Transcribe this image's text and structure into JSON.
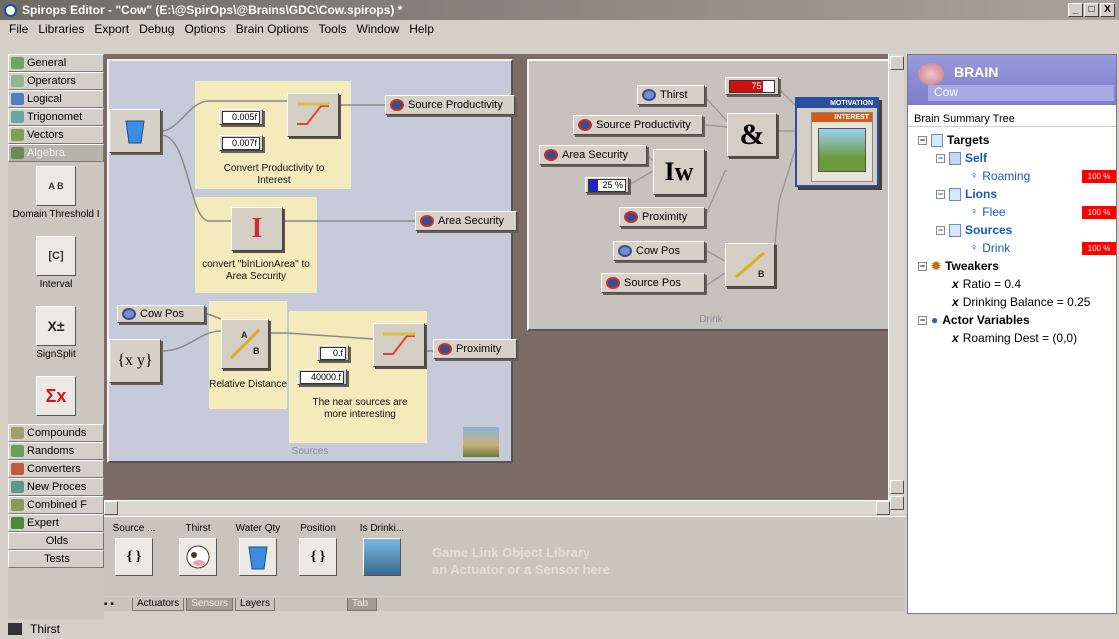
{
  "window": {
    "title": "Spirops Editor - \"Cow\" (E:\\@SpirOps\\@Brains\\GDC\\Cow.spirops) *",
    "min": "_",
    "max": "□",
    "close": "X"
  },
  "menu": [
    "File",
    "Libraries",
    "Export",
    "Debug",
    "Options",
    "Brain Options",
    "Tools",
    "Window",
    "Help"
  ],
  "palette": {
    "categories_top": [
      "General",
      "Operators",
      "Logical",
      "Trigonomet",
      "Vectors",
      "Algebra"
    ],
    "tools": [
      {
        "label": "Domain Threshold I",
        "glyph": "A B"
      },
      {
        "label": "Interval",
        "glyph": "[C]"
      },
      {
        "label": "SignSplit",
        "glyph": "X±"
      },
      {
        "label": "",
        "glyph": "Σx"
      }
    ],
    "categories_bottom": [
      "Compounds",
      "Randoms",
      "Converters",
      "New Proces",
      "Combined F",
      "Expert",
      "Olds",
      "Tests"
    ]
  },
  "sources_sheet": {
    "caption": "Sources",
    "values": {
      "v1": "0.005f",
      "v2": "0.007f",
      "v3": "0.f",
      "v4": "40000.f"
    },
    "outputs": [
      "Source Productivity",
      "Area Security",
      "Proximity"
    ],
    "input_cowpos": "Cow Pos",
    "captions": {
      "c1": "Convert Productivity to Interest",
      "c2": "convert \"bInLionArea\" to Area Security",
      "c3": "Relative Distance",
      "c4": "The near sources are more interesting"
    },
    "vec_glyph": "{x y}"
  },
  "drink_sheet": {
    "caption": "Drink",
    "inputs": [
      "Thirst",
      "Source Productivity",
      "Area Security",
      "Proximity",
      "Cow Pos",
      "Source Pos"
    ],
    "pct_75": "75 %",
    "pct_25": "25 %",
    "motivation": "MOTIVATION",
    "interest": "INTEREST",
    "and_glyph": "&",
    "iw_glyph": "Iw"
  },
  "library": {
    "items": [
      "Source ...",
      "Thirst",
      "Water Qty",
      "Position",
      "Is Drinki..."
    ],
    "ghost": [
      "Game Link Object Library",
      "an Actuator or a Sensor here"
    ],
    "tabs": [
      "Actuators",
      "Sensors",
      "Layers"
    ],
    "tab2": "Tab"
  },
  "brain": {
    "title": "BRAIN",
    "name": "Cow",
    "tree_title": "Brain Summary Tree",
    "tree": {
      "targets": "Targets",
      "self": "Self",
      "roaming": "Roaming",
      "lions": "Lions",
      "flee": "Flee",
      "sources": "Sources",
      "drink": "Drink",
      "tweakers": "Tweakers",
      "ratio": "Ratio = 0.4",
      "balance": "Drinking Balance = 0.25",
      "actor_vars": "Actor Variables",
      "roaming_dest": "Roaming Dest = (0,0)"
    },
    "badge": "100 %"
  },
  "status": {
    "text": "Thirst"
  }
}
